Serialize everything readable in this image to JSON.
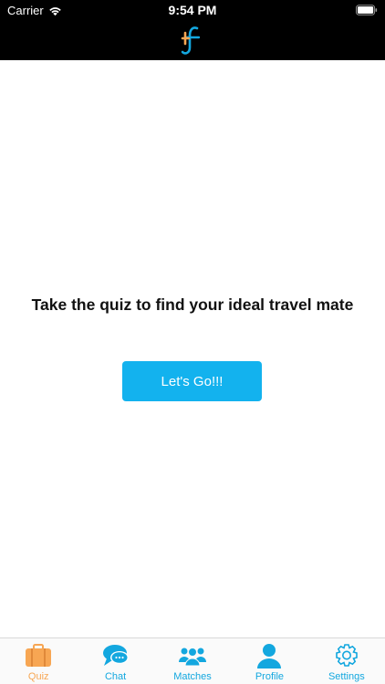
{
  "status_bar": {
    "carrier": "Carrier",
    "time": "9:54 PM"
  },
  "header": {
    "logo_icon": "tf-logo-icon",
    "colors": {
      "background": "#000000",
      "logo_orange": "#f7a653",
      "logo_blue": "#13a7df"
    }
  },
  "main": {
    "prompt": "Take the quiz to find your ideal travel mate",
    "button_label": "Let's Go!!!"
  },
  "tabs": [
    {
      "label": "Quiz",
      "icon": "briefcase-icon",
      "active": true
    },
    {
      "label": "Chat",
      "icon": "chat-bubble-icon",
      "active": false
    },
    {
      "label": "Matches",
      "icon": "group-icon",
      "active": false
    },
    {
      "label": "Profile",
      "icon": "person-icon",
      "active": false
    },
    {
      "label": "Settings",
      "icon": "gear-icon",
      "active": false
    }
  ],
  "colors": {
    "accent": "#13b2ee",
    "tab_active": "#f7a653",
    "tab_inactive": "#13a7df"
  }
}
